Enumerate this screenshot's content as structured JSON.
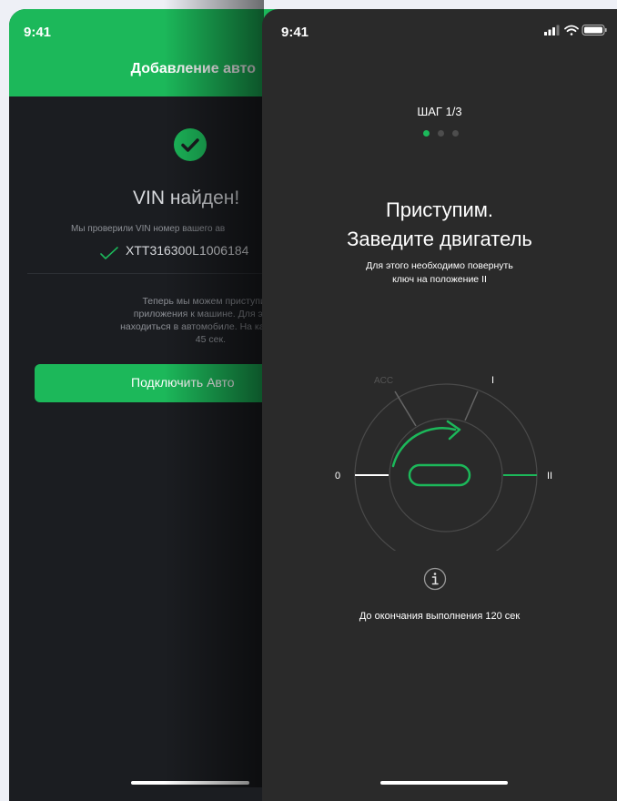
{
  "back_screen": {
    "time": "9:41",
    "title": "Добавление авто",
    "vin_found": "VIN найден!",
    "checked_text": "Мы проверили VIN номер вашего ав",
    "vin": "XTT316300L1006184",
    "description_lines": [
      "Теперь мы можем приступить к под",
      "приложения к машине. Для этого вам",
      "находиться в автомобиле. На каждый эт",
      "45 сек."
    ],
    "connect_button": "Подключить Авто",
    "accent_color": "#1cb85a"
  },
  "front_screen": {
    "time": "9:41",
    "step_label": "ШАГ 1/3",
    "step_total": 3,
    "step_current": 1,
    "title_line1": "Приступим.",
    "title_line2": "Заведите двигатель",
    "subtitle_line1": "Для этого необходимо повернуть",
    "subtitle_line2": "ключ на положение II",
    "dial_labels": {
      "acc": "ACC",
      "one": "I",
      "zero": "0",
      "two": "II"
    },
    "info_icon": "info-circle-icon",
    "timer_text": "До окончания выполнения 120 сек"
  }
}
